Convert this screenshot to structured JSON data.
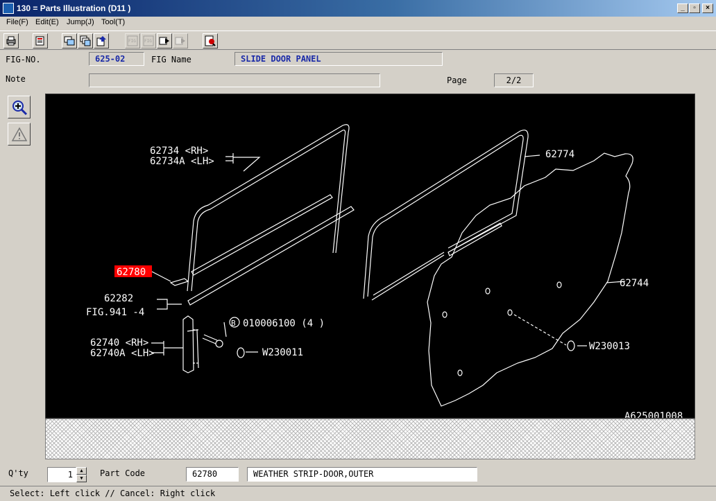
{
  "window": {
    "title": "130 = Parts Illustration (D11  )",
    "buttons": {
      "minimize": "_",
      "maximize": "▫",
      "close": "×"
    }
  },
  "menu": [
    {
      "label": "File(F)"
    },
    {
      "label": "Edit(E)"
    },
    {
      "label": "Jump(J)"
    },
    {
      "label": "Tool(T)"
    }
  ],
  "toolbar": {
    "icons": [
      "print-icon",
      "book-icon",
      "screen-icon",
      "copy-screens-icon",
      "page-up-icon",
      "fig-back-icon",
      "fig-forward-icon",
      "window-back-icon",
      "window-forward-icon",
      "fig-search-icon"
    ],
    "fig_icon_label": "FIG"
  },
  "fig": {
    "no_label": "FIG-NO.",
    "no_value": "625-02",
    "name_label": "FIG Name",
    "name_value": "SLIDE DOOR PANEL",
    "note_label": "Note",
    "note_value": "",
    "page_label": "Page",
    "page_value": "2/2"
  },
  "side_tools": [
    "zoom-in-icon",
    "warning-icon"
  ],
  "drawing": {
    "callouts": {
      "p62734": "62734  <RH>",
      "p62734a": "62734A <LH>",
      "p62774": "62774",
      "p62780": "62780",
      "p62282": "62282",
      "fig941": "FIG.941 -4",
      "bolt": "010006100 (4 )",
      "bolt_symbol": "B",
      "p62740": "62740  <RH>",
      "p62740a": "62740A <LH>",
      "w230011": "W230011",
      "p62744": "62744",
      "w230013": "W230013",
      "illustration_id": "A625001008"
    },
    "highlight_color": "#ff0000"
  },
  "bottom": {
    "qty_label": "Q'ty",
    "qty_value": "1",
    "part_code_label": "Part Code",
    "part_code_value": "62780",
    "part_name": "WEATHER STRIP-DOOR,OUTER"
  },
  "status": "Select: Left click // Cancel: Right click"
}
